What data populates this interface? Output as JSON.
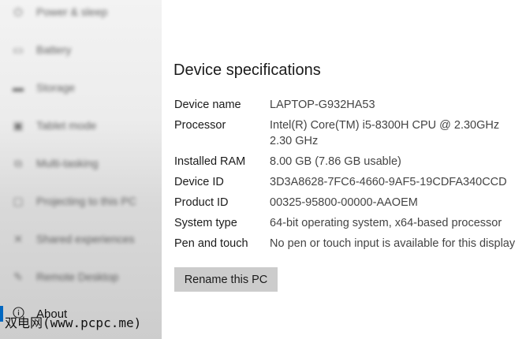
{
  "sidebar": {
    "items": [
      {
        "label": "Power & sleep",
        "icon": "power-icon"
      },
      {
        "label": "Battery",
        "icon": "battery-icon"
      },
      {
        "label": "Storage",
        "icon": "storage-icon"
      },
      {
        "label": "Tablet mode",
        "icon": "tablet-icon"
      },
      {
        "label": "Multi-tasking",
        "icon": "multitasking-icon"
      },
      {
        "label": "Projecting to this PC",
        "icon": "projecting-icon"
      },
      {
        "label": "Shared experiences",
        "icon": "shared-icon"
      },
      {
        "label": "Remote Desktop",
        "icon": "remote-desktop-icon"
      },
      {
        "label": "About",
        "icon": "info-icon",
        "active": true
      }
    ]
  },
  "main": {
    "title": "Device specifications",
    "specs": [
      {
        "key": "Device name",
        "value": "LAPTOP-G932HA53"
      },
      {
        "key": "Processor",
        "value": "Intel(R) Core(TM) i5-8300H CPU @ 2.30GHz",
        "value2": "2.30 GHz"
      },
      {
        "key": "Installed RAM",
        "value": "8.00 GB (7.86 GB usable)"
      },
      {
        "key": "Device ID",
        "value": "3D3A8628-7FC6-4660-9AF5-19CDFA340CCD"
      },
      {
        "key": "Product ID",
        "value": "00325-95800-00000-AAOEM"
      },
      {
        "key": "System type",
        "value": "64-bit operating system, x64-based processor"
      },
      {
        "key": "Pen and touch",
        "value": "No pen or touch input is available for this display"
      }
    ],
    "rename_button": "Rename this PC"
  },
  "watermark": "双电网(www.pcpc.me)",
  "colors": {
    "accent": "#0067c0",
    "button_bg": "#cccccc"
  }
}
